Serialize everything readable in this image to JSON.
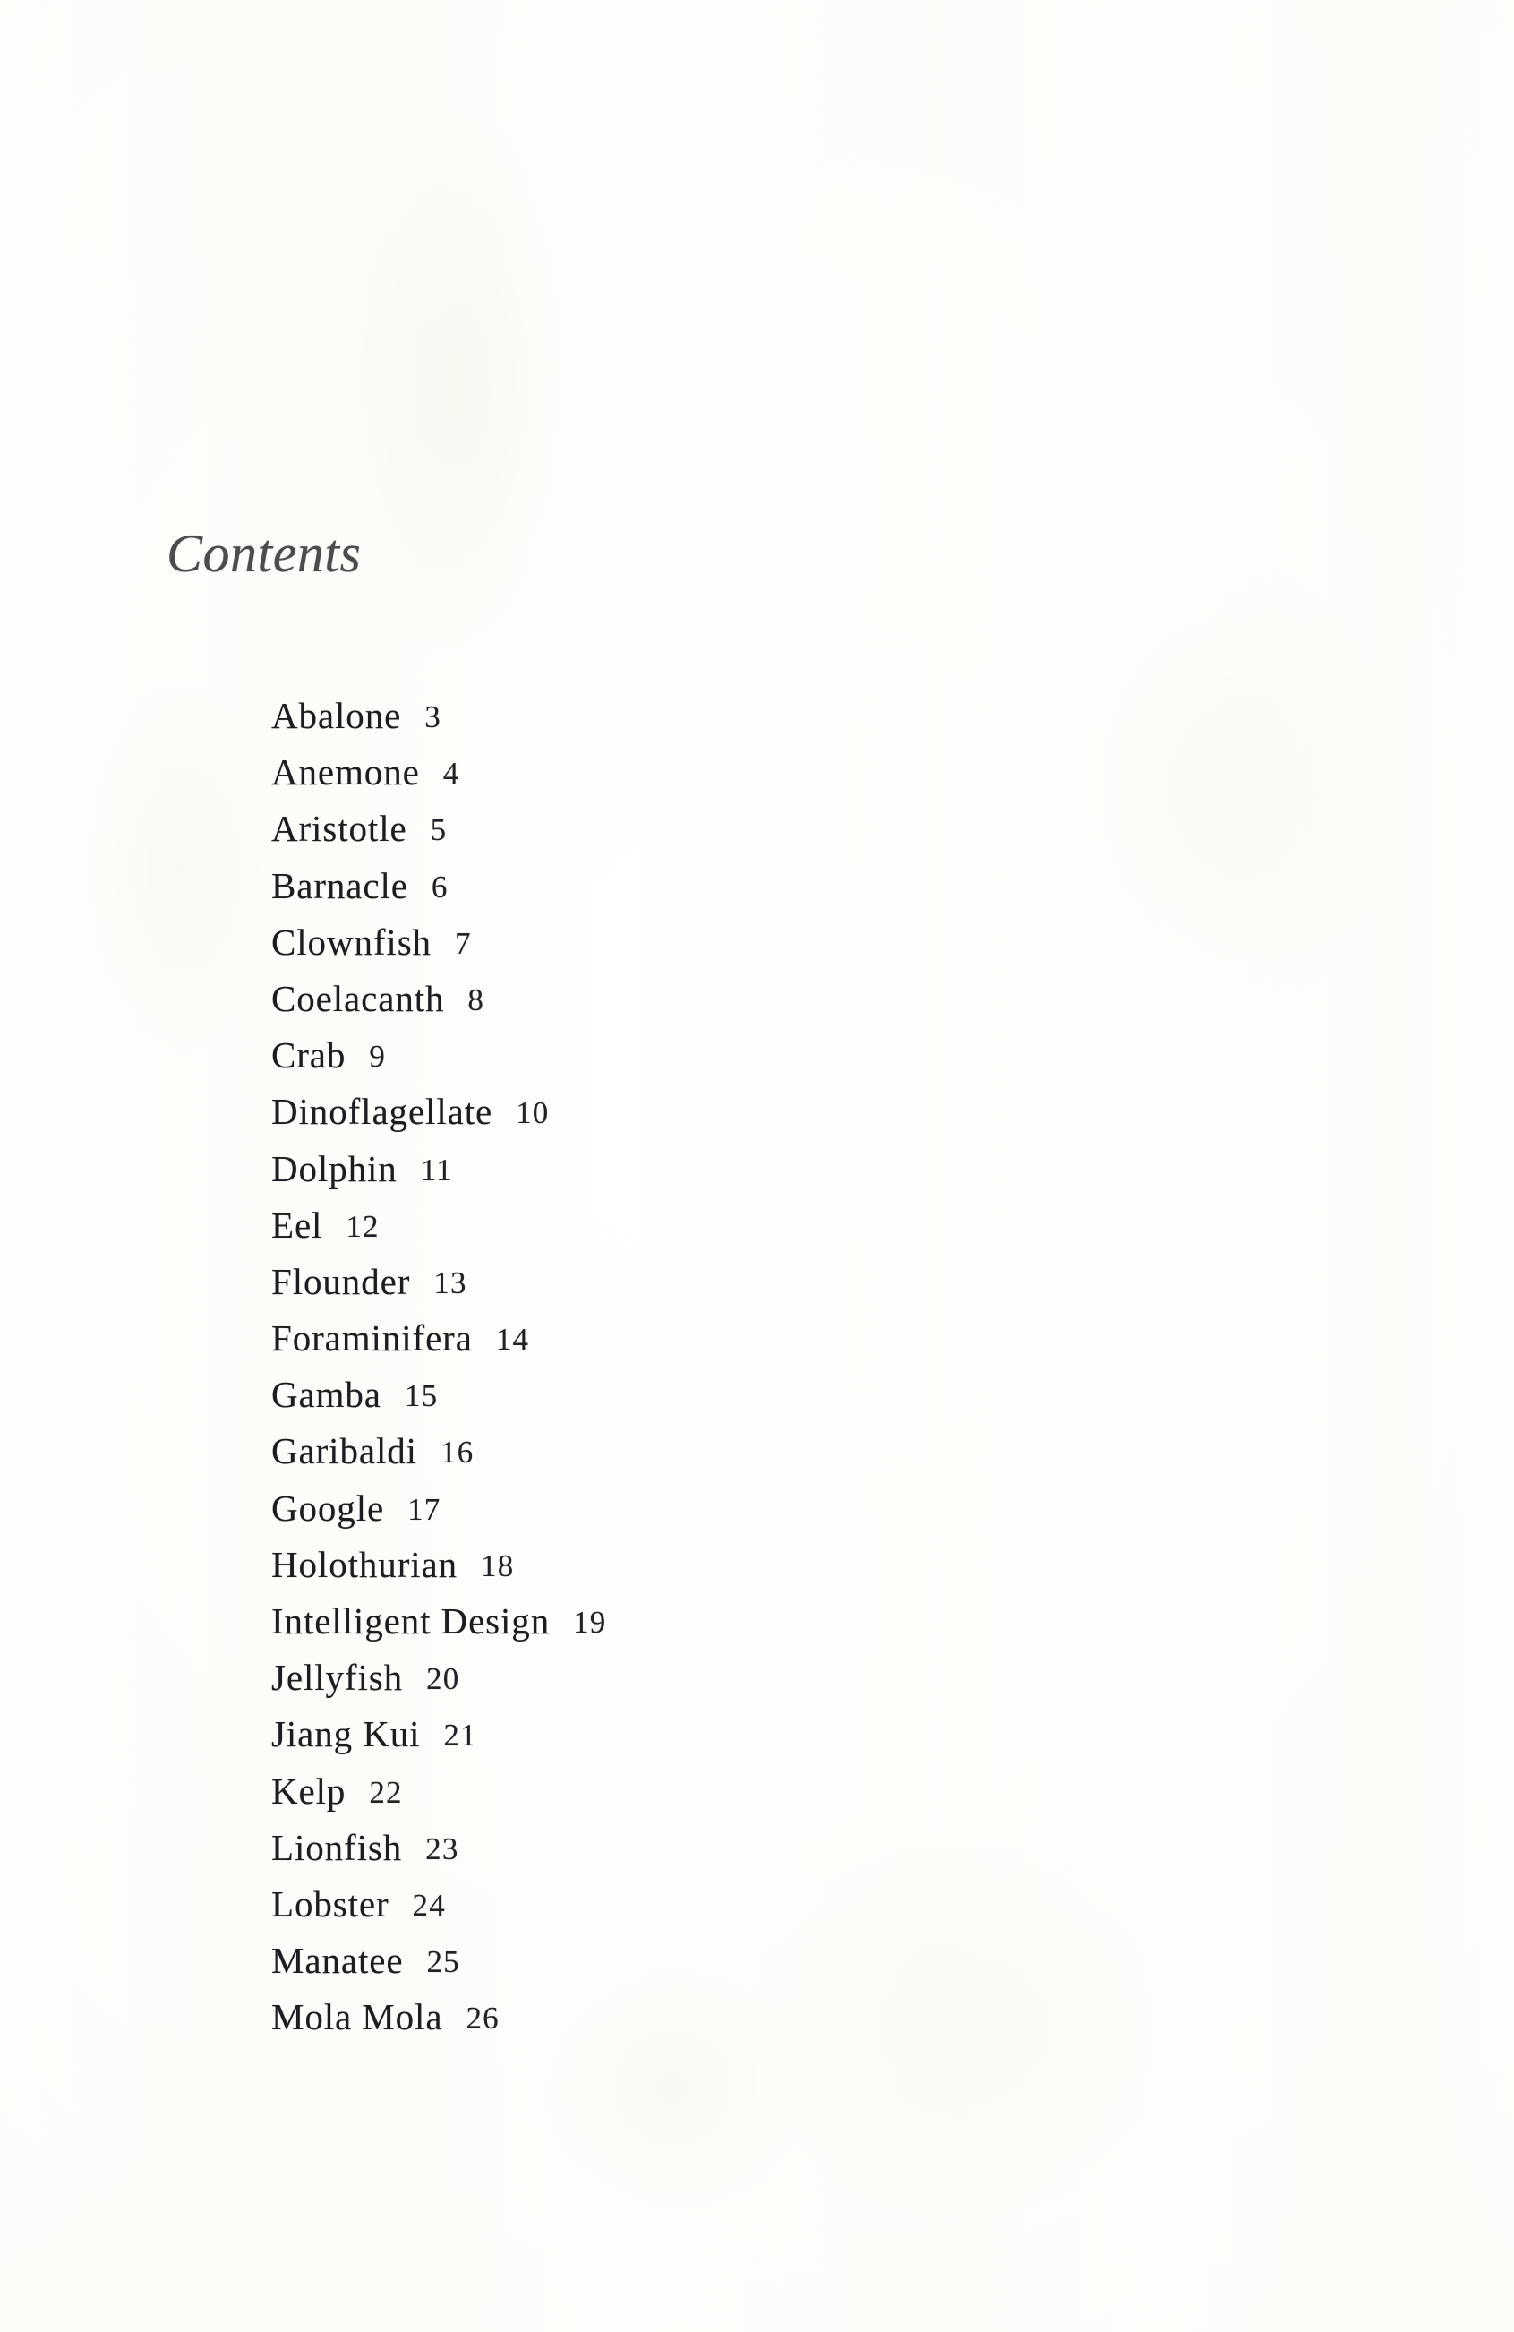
{
  "page": {
    "title": "Contents",
    "background_color": "#fefefe",
    "text_color": "#1d1d20",
    "title_color": "#4c4c4c"
  },
  "toc": {
    "heading": "Contents",
    "entries": [
      {
        "name": "Abalone",
        "page": "3"
      },
      {
        "name": "Anemone",
        "page": "4"
      },
      {
        "name": "Aristotle",
        "page": "5"
      },
      {
        "name": "Barnacle",
        "page": "6"
      },
      {
        "name": "Clownfish",
        "page": "7"
      },
      {
        "name": "Coelacanth",
        "page": "8"
      },
      {
        "name": "Crab",
        "page": "9"
      },
      {
        "name": "Dinoflagellate",
        "page": "10"
      },
      {
        "name": "Dolphin",
        "page": "11"
      },
      {
        "name": "Eel",
        "page": "12"
      },
      {
        "name": "Flounder",
        "page": "13"
      },
      {
        "name": "Foraminifera",
        "page": "14"
      },
      {
        "name": "Gamba",
        "page": "15"
      },
      {
        "name": "Garibaldi",
        "page": "16"
      },
      {
        "name": "Google",
        "page": "17"
      },
      {
        "name": "Holothurian",
        "page": "18"
      },
      {
        "name": "Intelligent Design",
        "page": "19"
      },
      {
        "name": "Jellyfish",
        "page": "20"
      },
      {
        "name": "Jiang Kui",
        "page": "21"
      },
      {
        "name": "Kelp",
        "page": "22"
      },
      {
        "name": "Lionfish",
        "page": "23"
      },
      {
        "name": "Lobster",
        "page": "24"
      },
      {
        "name": "Manatee",
        "page": "25"
      },
      {
        "name": "Mola Mola",
        "page": "26"
      }
    ]
  }
}
